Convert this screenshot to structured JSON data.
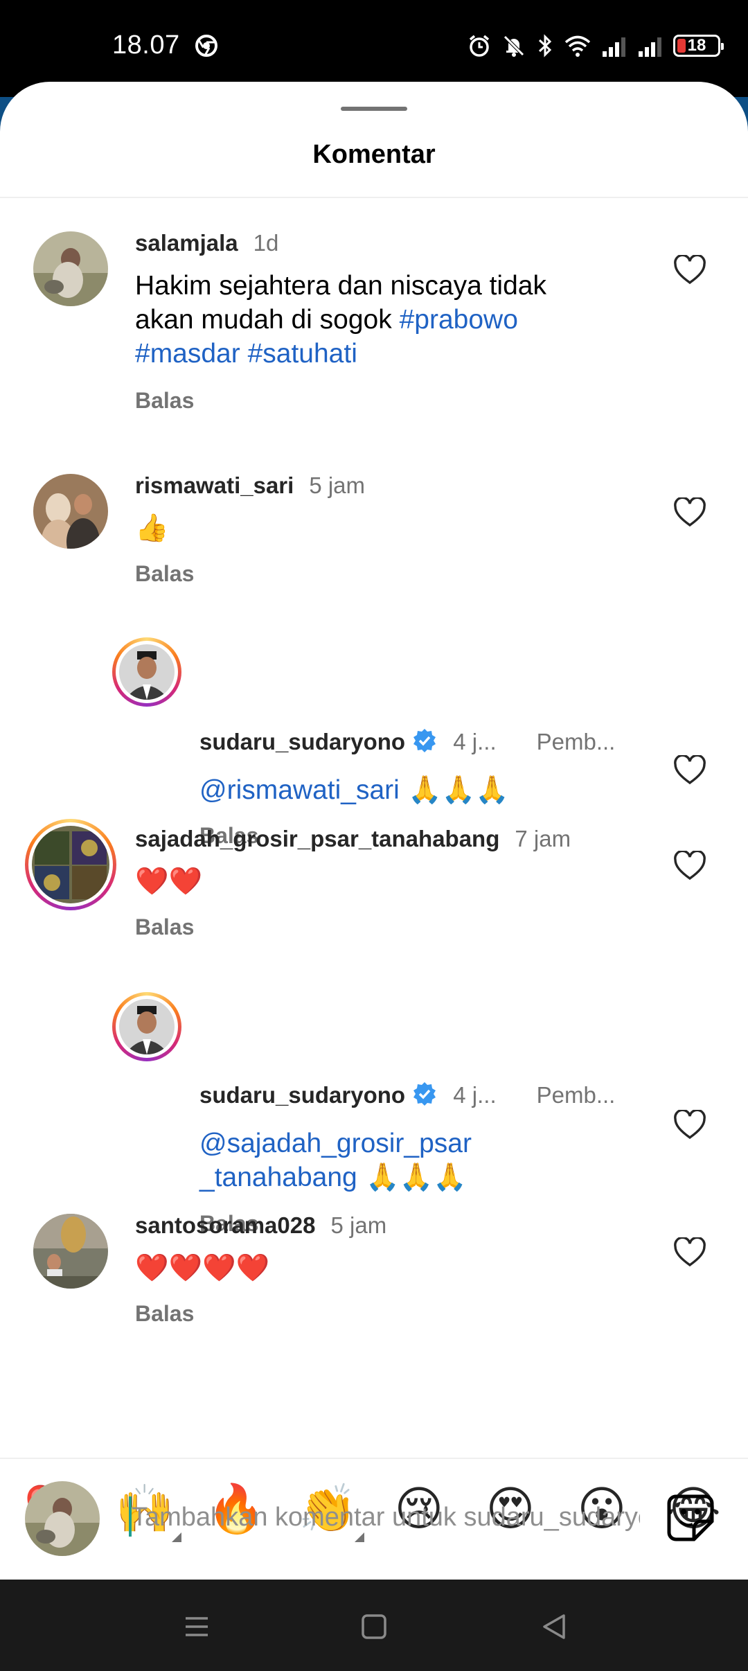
{
  "status_bar": {
    "time": "18.07",
    "battery_level": "18",
    "icons": [
      "chrome-icon",
      "alarm-icon",
      "mute-icon",
      "bluetooth-icon",
      "wifi-icon",
      "signal-icon",
      "signal-icon",
      "battery-icon"
    ]
  },
  "sheet": {
    "title": "Komentar"
  },
  "comments": [
    {
      "username": "salamjala",
      "time": "1d",
      "text_parts": [
        "Hakim sejahtera dan niscaya tidak",
        "akan mudah di sogok ",
        "#prabowo",
        "#masdar",
        "#satuhati"
      ],
      "reply_label": "Balas"
    },
    {
      "username": "rismawati_sari",
      "time": "5 jam",
      "text": "👍",
      "reply_label": "Balas"
    },
    {
      "username": "sudaru_sudaryono",
      "time": "4 j...",
      "meta": "Pemb...",
      "mention": "@rismawati_sari",
      "text": " 🙏🙏🙏",
      "reply_label": "Balas"
    },
    {
      "username": "sajadah_grosir_psar_tanahabang",
      "time": "7 jam",
      "text": "❤️❤️",
      "reply_label": "Balas"
    },
    {
      "username": "sudaru_sudaryono",
      "time": "4 j...",
      "meta": "Pemb...",
      "mention_line1": "@sajadah_grosir_psar",
      "mention_line2": "_tanahabang",
      "text": " 🙏🙏🙏",
      "reply_label": "Balas"
    },
    {
      "username": "santosorama028",
      "time": "5 jam",
      "text": "❤️❤️❤️❤️",
      "reply_label": "Balas"
    }
  ],
  "emoji_bar": [
    "❤️",
    "🙌",
    "🔥",
    "👏",
    "😢",
    "😍",
    "😮",
    "😂"
  ],
  "composer": {
    "placeholder": "Tambahkan komentar untuk sudaru_sudaryono..."
  },
  "colors": {
    "link": "#1f62c4",
    "muted": "#737373",
    "verified": "#3897f0"
  }
}
